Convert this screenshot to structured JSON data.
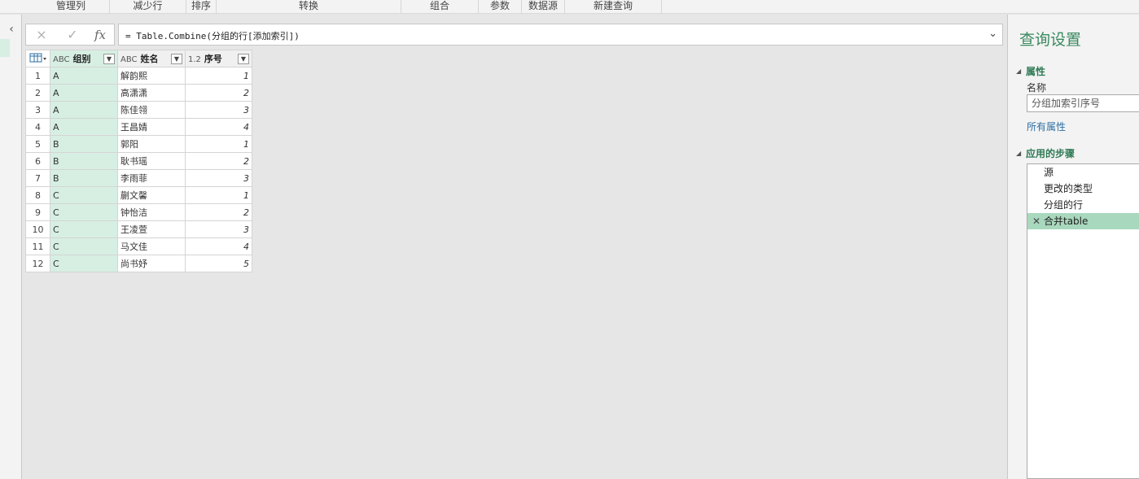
{
  "ribbon": {
    "groups": [
      "管理列",
      "减少行",
      "排序",
      "转换",
      "组合",
      "参数",
      "数据源",
      "新建查询"
    ]
  },
  "formula_bar": {
    "cancel_icon": "×",
    "confirm_icon": "✓",
    "fx_label": "fx",
    "formula": "= Table.Combine(分组的行[添加索引])",
    "expand_icon": "⌄"
  },
  "grid": {
    "corner_icon": "table-icon",
    "columns": [
      {
        "type_label": "ABC",
        "name": "组别"
      },
      {
        "type_label": "ABC",
        "name": "姓名"
      },
      {
        "type_label": "1.2",
        "name": "序号"
      }
    ],
    "rows": [
      {
        "n": "1",
        "group": "A",
        "name": "解韵熙",
        "idx": "1"
      },
      {
        "n": "2",
        "group": "A",
        "name": "高潇潇",
        "idx": "2"
      },
      {
        "n": "3",
        "group": "A",
        "name": "陈佳翎",
        "idx": "3"
      },
      {
        "n": "4",
        "group": "A",
        "name": "王昌婧",
        "idx": "4"
      },
      {
        "n": "5",
        "group": "B",
        "name": "郭阳",
        "idx": "1"
      },
      {
        "n": "6",
        "group": "B",
        "name": "耿书瑶",
        "idx": "2"
      },
      {
        "n": "7",
        "group": "B",
        "name": "李雨菲",
        "idx": "3"
      },
      {
        "n": "8",
        "group": "C",
        "name": "蒯文馨",
        "idx": "1"
      },
      {
        "n": "9",
        "group": "C",
        "name": "钟怡洁",
        "idx": "2"
      },
      {
        "n": "10",
        "group": "C",
        "name": "王凌萱",
        "idx": "3"
      },
      {
        "n": "11",
        "group": "C",
        "name": "马文佳",
        "idx": "4"
      },
      {
        "n": "12",
        "group": "C",
        "name": "尚书妤",
        "idx": "5"
      }
    ]
  },
  "query_settings": {
    "title": "查询设置",
    "properties_header": "属性",
    "name_label": "名称",
    "name_value": "分组加索引序号",
    "all_properties_link": "所有属性",
    "applied_steps_header": "应用的步骤",
    "steps": [
      "源",
      "更改的类型",
      "分组的行",
      "合并table"
    ],
    "selected_step": "合并table"
  },
  "colors": {
    "accent_green": "#3a8a5f",
    "column_highlight": "#d7efe3",
    "selected_step": "#a8d8bd"
  }
}
